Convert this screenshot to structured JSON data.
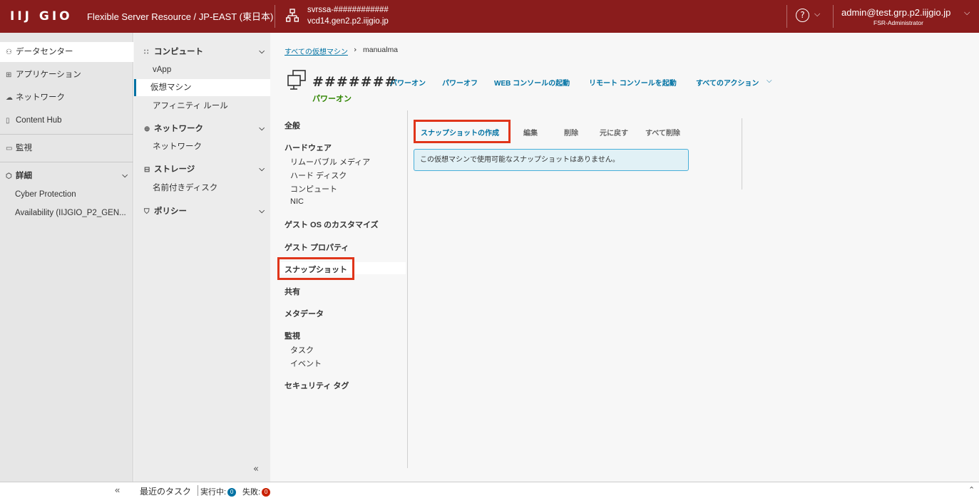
{
  "header": {
    "logo": "IIJ GIO",
    "product": "Flexible Server Resource / JP-EAST (東日本)",
    "org_line1": "svrssa-############",
    "org_line2": "vcd14.gen2.p2.iijgio.jp",
    "help_glyph": "?",
    "user": "admin@test.grp.p2.iijgio.jp",
    "role": "FSR-Administrator",
    "brand_color": "#8a1c1c"
  },
  "nav1": {
    "items": [
      {
        "label": "データセンター",
        "icon": "datacenter-icon"
      },
      {
        "label": "アプリケーション",
        "icon": "grid-icon"
      },
      {
        "label": "ネットワーク",
        "icon": "cloud-icon"
      },
      {
        "label": "Content Hub",
        "icon": "book-icon"
      },
      {
        "label": "監視",
        "icon": "monitor-icon"
      },
      {
        "label": "詳細",
        "icon": "node-icon"
      },
      {
        "label": "Cyber Protection"
      },
      {
        "label": "Availability (IIJGIO_P2_GEN..."
      }
    ]
  },
  "nav2": {
    "compute": "コンピュート",
    "vapp": "vApp",
    "vm": "仮想マシン",
    "affinity": "アフィニティ ルール",
    "network": "ネットワーク",
    "network_sub": "ネットワーク",
    "storage": "ストレージ",
    "named_disk": "名前付きディスク",
    "policy": "ポリシー"
  },
  "breadcrumb": {
    "link": "すべての仮想マシン",
    "current": "manualma"
  },
  "vm": {
    "name": "#######",
    "status": "パワーオン",
    "status_color": "#2f8400"
  },
  "actions": {
    "power_on": "パワーオン",
    "power_off": "パワーオフ",
    "web_console": "WEB コンソールの起動",
    "remote_console": "リモート コンソールを起動",
    "all_actions": "すべてのアクション"
  },
  "sections": {
    "general": "全般",
    "hardware": "ハードウェア",
    "removable": "リムーバブル メディア",
    "hard_disk": "ハード ディスク",
    "compute": "コンピュート",
    "nic": "NIC",
    "guest_os": "ゲスト OS のカスタマイズ",
    "guest_props": "ゲスト プロパティ",
    "snapshot": "スナップショット",
    "sharing": "共有",
    "metadata": "メタデータ",
    "monitor": "監視",
    "tasks": "タスク",
    "events": "イベント",
    "security_tag": "セキュリティ タグ"
  },
  "snapshot_toolbar": {
    "create": "スナップショットの作成",
    "edit": "編集",
    "delete": "削除",
    "revert": "元に戻す",
    "delete_all": "すべて削除"
  },
  "info_message": "この仮想マシンで使用可能なスナップショットはありません。",
  "footer": {
    "recent_tasks": "最近のタスク",
    "running_label": "実行中:",
    "running_count": "0",
    "failed_label": "失敗:",
    "failed_count": "0",
    "running_color": "#0072a3",
    "failed_color": "#c92100"
  },
  "highlight_color": "#e0351a"
}
